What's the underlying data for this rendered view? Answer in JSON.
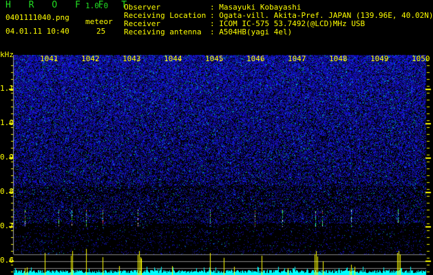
{
  "header": {
    "app_title": "H R O F F T",
    "version": "1.0.0",
    "filename": "0401111040.png",
    "datetime": "04.01.11 10:40",
    "meteor_label": "meteor",
    "meteor_count": "25"
  },
  "station": [
    {
      "label": "Observer",
      "value": ": Masayuki Kobayashi"
    },
    {
      "label": "Receiving Location",
      "value": ": Ogata-vill. Akita-Pref. JAPAN (139.96E, 40.02N)"
    },
    {
      "label": "Receiver",
      "value": ": ICOM IC-575 53.7492(@LCD)MHz USB"
    },
    {
      "label": "Receiving antenna",
      "value": ": A504HB(yagi 4el)"
    }
  ],
  "spectrogram": {
    "y_unit": "kHz",
    "x_ticks": [
      "1041",
      "1042",
      "1043",
      "1044",
      "1045",
      "1046",
      "1047",
      "1048",
      "1049",
      "1050"
    ],
    "y_ticks": [
      "1.1",
      "1.0",
      "0.9",
      "0.8",
      "0.7",
      "0.6"
    ],
    "colors": {
      "text": "#ffff00",
      "title": "#22dd22",
      "noise": "#2222ee",
      "baseline": "#00ffff",
      "meteor_bar": "#ffff00",
      "grid": "#888888"
    }
  }
}
